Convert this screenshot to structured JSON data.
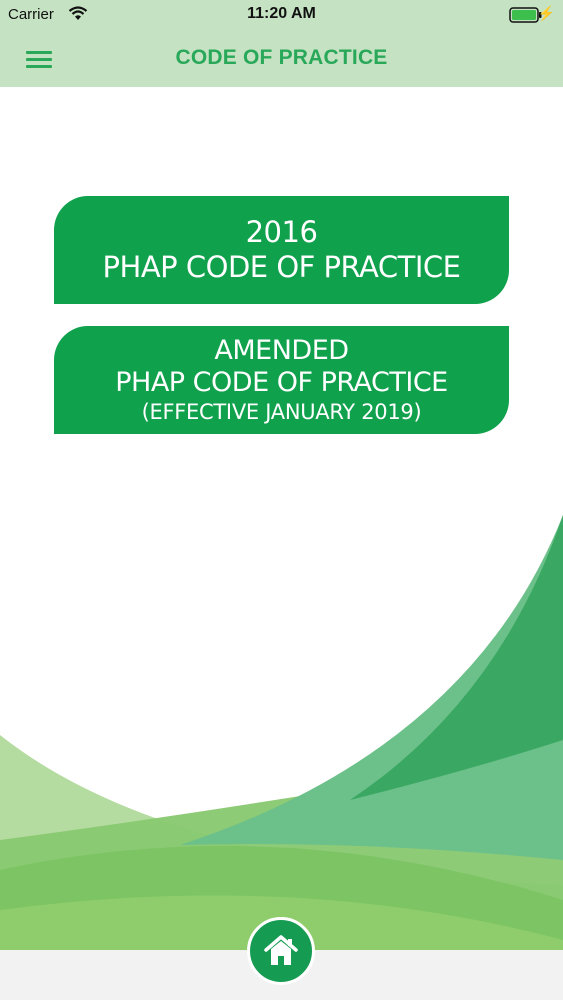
{
  "status_bar": {
    "carrier": "Carrier",
    "time": "11:20 AM",
    "icons": [
      "wifi-icon",
      "battery-icon",
      "charging-bolt-icon"
    ]
  },
  "nav_bar": {
    "title": "CODE OF PRACTICE",
    "menu_icon": "hamburger-menu-icon"
  },
  "buttons": [
    {
      "line1": "2016",
      "line2": "PHAP CODE OF PRACTICE"
    },
    {
      "line1": "AMENDED",
      "line2": "PHAP CODE OF PRACTICE",
      "line3": "(EFFECTIVE JANUARY 2019)"
    }
  ],
  "footer": {
    "home_icon": "home-icon"
  },
  "colors": {
    "header_bg": "#c5e3c3",
    "accent": "#2aa85a",
    "button_bg": "#0fa14c",
    "home_button_bg": "#169c52"
  }
}
